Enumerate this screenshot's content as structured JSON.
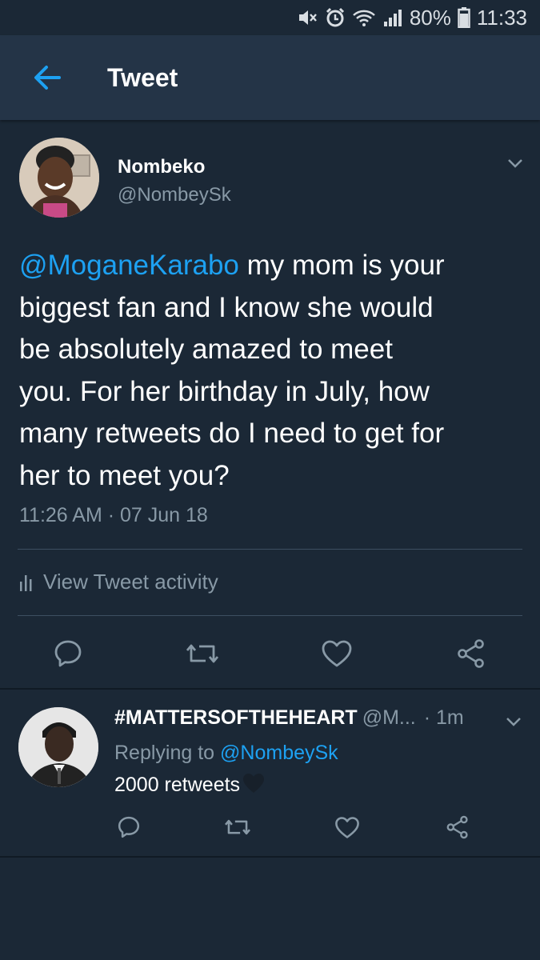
{
  "status_bar": {
    "battery": "80%",
    "time": "11:33"
  },
  "header": {
    "title": "Tweet",
    "back_icon": "arrow-left-icon"
  },
  "tweet": {
    "author_name": "Nombeko",
    "author_handle": "@NombeySk",
    "mention": "@MoganeKarabo",
    "body_lines": [
      " my mom is your",
      "biggest fan and I know she would",
      "be absolutely amazed to meet",
      "you. For her birthday in July, how",
      "many retweets do I need to get for",
      "her to meet you?"
    ],
    "timestamp": "11:26 AM · 07 Jun 18",
    "activity_label": "View Tweet activity"
  },
  "reply": {
    "author_name": "#MATTERSOFTHEHEART",
    "author_handle": "@M...",
    "time": "· 1m",
    "replying_prefix": "Replying to ",
    "replying_to": "@NombeySk",
    "text": "2000 retweets",
    "emoji": "black-heart"
  },
  "colors": {
    "background": "#1b2836",
    "header": "#243447",
    "accent": "#1da1f2",
    "secondary_text": "#8899a6",
    "divider": "#3d4f61"
  },
  "icons": {
    "reply": "speech-bubble-icon",
    "retweet": "retweet-icon",
    "like": "heart-icon",
    "share": "share-icon",
    "caret": "chevron-down-icon"
  }
}
